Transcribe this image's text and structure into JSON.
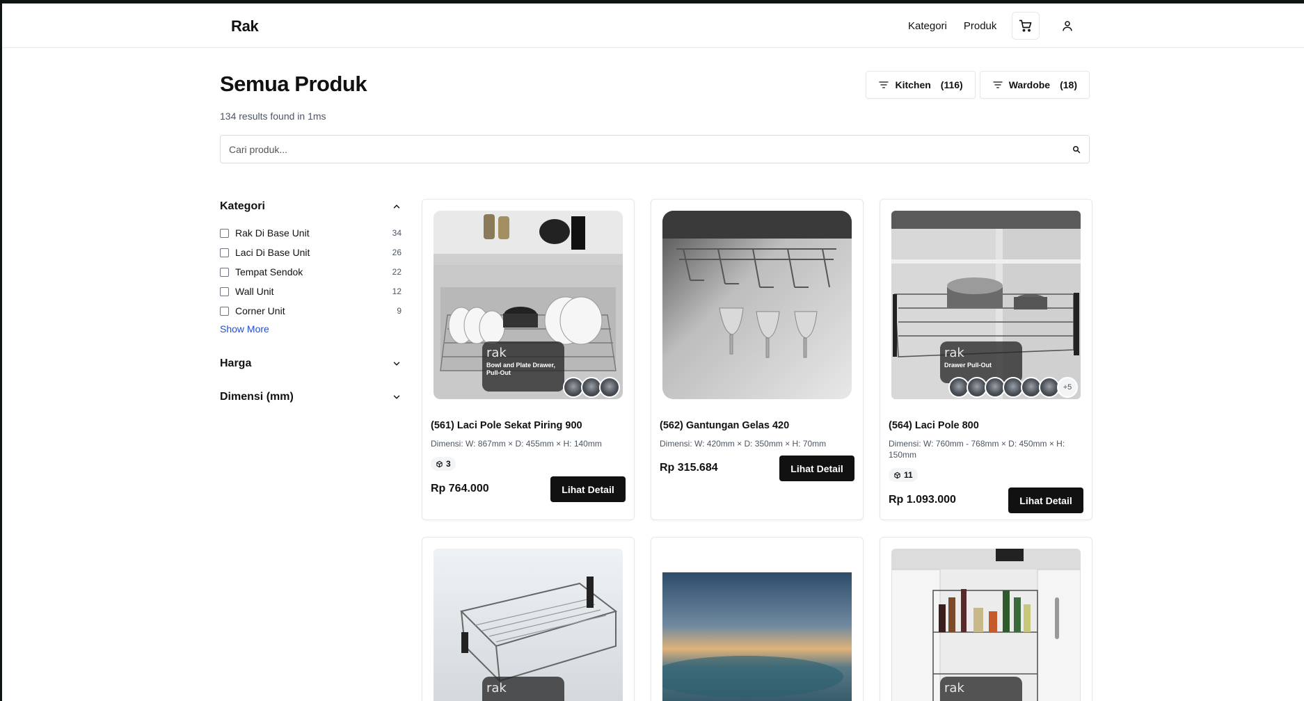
{
  "header": {
    "logo": "Rak",
    "nav": [
      "Kategori",
      "Produk"
    ],
    "cart_icon": "cart-icon",
    "user_icon": "user-icon"
  },
  "page": {
    "title": "Semua Produk",
    "results": "134 results found in 1ms"
  },
  "quick_filters": [
    {
      "label": "Kitchen",
      "count": "(116)",
      "icon": "filter-icon"
    },
    {
      "label": "Wardobe",
      "count": "(18)",
      "icon": "filter-icon"
    }
  ],
  "search": {
    "placeholder": "Cari produk...",
    "value": "",
    "icon": "search-icon"
  },
  "sidebar": {
    "kategori": {
      "title": "Kategori",
      "expanded": true,
      "items": [
        {
          "label": "Rak Di Base Unit",
          "count": "34"
        },
        {
          "label": "Laci Di Base Unit",
          "count": "26"
        },
        {
          "label": "Tempat Sendok",
          "count": "22"
        },
        {
          "label": "Wall Unit",
          "count": "12"
        },
        {
          "label": "Corner Unit",
          "count": "9"
        }
      ],
      "show_more": "Show More"
    },
    "harga": {
      "title": "Harga",
      "expanded": false
    },
    "dimensi": {
      "title": "Dimensi (mm)",
      "expanded": false
    }
  },
  "products": [
    {
      "title": "(561) Laci Pole Sekat Piring 900",
      "dimensions": "Dimensi: W: 867mm × D: 455mm × H: 140mm",
      "variants": "3",
      "price": "Rp 764.000",
      "button": "Lihat Detail",
      "overlay_brand": "rak",
      "overlay_text": "Bowl and Plate Drawer, Pull-Out"
    },
    {
      "title": "(562) Gantungan Gelas 420",
      "dimensions": "Dimensi: W: 420mm × D: 350mm × H: 70mm",
      "variants": "",
      "price": "Rp 315.684",
      "button": "Lihat Detail"
    },
    {
      "title": "(564) Laci Pole 800",
      "dimensions": "Dimensi: W: 760mm - 768mm × D: 450mm × H: 150mm",
      "variants": "11",
      "price": "Rp 1.093.000",
      "button": "Lihat Detail",
      "overlay_brand": "rak",
      "overlay_text": "Drawer Pull-Out",
      "thumb_more": "+5"
    },
    {
      "overlay_brand": "rak"
    },
    {},
    {
      "overlay_brand": "rak"
    }
  ],
  "colors": {
    "primary_button": "#111111",
    "link": "#1d4ed8",
    "border": "#e5e7eb"
  }
}
